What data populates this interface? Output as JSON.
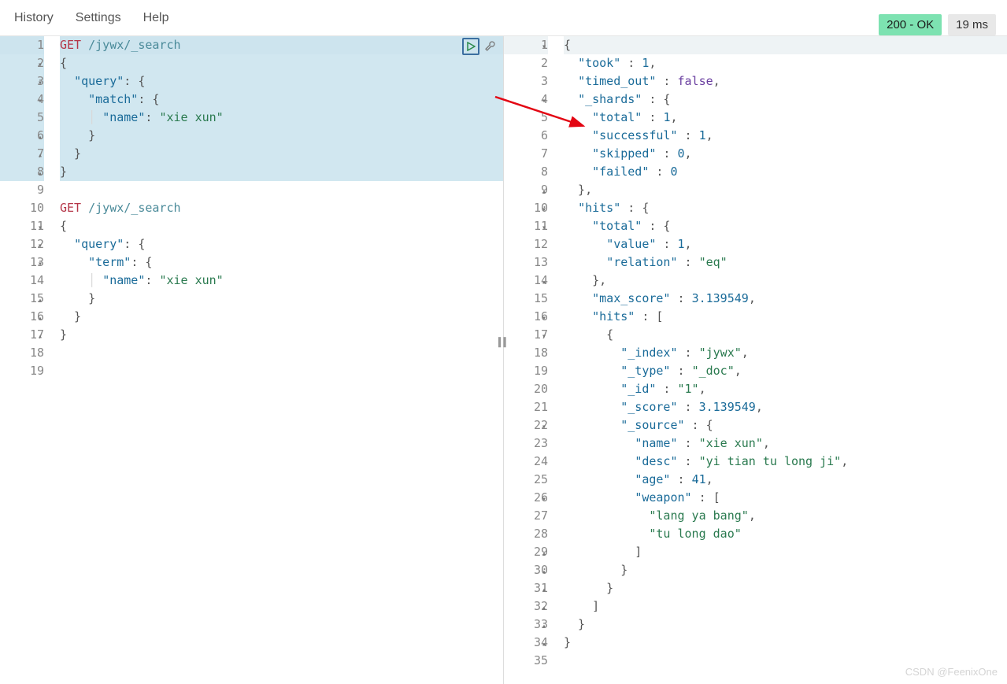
{
  "menu": {
    "history": "History",
    "settings": "Settings",
    "help": "Help"
  },
  "status": {
    "code": "200 - OK",
    "time": "19 ms"
  },
  "watermark": "CSDN @FeenixOne",
  "left_lines": [
    {
      "n": 1,
      "hl": true,
      "first": true,
      "tokens": [
        {
          "t": "GET ",
          "c": "method"
        },
        {
          "t": "/jywx/_search",
          "c": "path"
        }
      ]
    },
    {
      "n": 2,
      "hl": true,
      "fold": "▾",
      "tokens": [
        {
          "t": "{",
          "c": "punct"
        }
      ]
    },
    {
      "n": 3,
      "hl": true,
      "fold": "▾",
      "tokens": [
        {
          "t": "  ",
          "c": ""
        },
        {
          "t": "\"query\"",
          "c": "key"
        },
        {
          "t": ": {",
          "c": "punct"
        }
      ]
    },
    {
      "n": 4,
      "hl": true,
      "fold": "▾",
      "tokens": [
        {
          "t": "    ",
          "c": ""
        },
        {
          "t": "\"match\"",
          "c": "key"
        },
        {
          "t": ": {",
          "c": "punct"
        }
      ]
    },
    {
      "n": 5,
      "hl": true,
      "tokens": [
        {
          "t": "    ",
          "c": ""
        },
        {
          "t": "| ",
          "c": "guide-txt"
        },
        {
          "t": "\"name\"",
          "c": "key"
        },
        {
          "t": ": ",
          "c": "punct"
        },
        {
          "t": "\"xie xun\"",
          "c": "str"
        }
      ]
    },
    {
      "n": 6,
      "hl": true,
      "fold": "▴",
      "tokens": [
        {
          "t": "    }",
          "c": "punct"
        }
      ]
    },
    {
      "n": 7,
      "hl": true,
      "fold": "▴",
      "tokens": [
        {
          "t": "  }",
          "c": "punct"
        }
      ]
    },
    {
      "n": 8,
      "hl": true,
      "fold": "▴",
      "tokens": [
        {
          "t": "}",
          "c": "punct"
        }
      ]
    },
    {
      "n": 9,
      "tokens": []
    },
    {
      "n": 10,
      "tokens": [
        {
          "t": "GET ",
          "c": "method"
        },
        {
          "t": "/jywx/_search",
          "c": "path"
        }
      ]
    },
    {
      "n": 11,
      "fold": "▾",
      "tokens": [
        {
          "t": "{",
          "c": "punct"
        }
      ]
    },
    {
      "n": 12,
      "fold": "▾",
      "tokens": [
        {
          "t": "  ",
          "c": ""
        },
        {
          "t": "\"query\"",
          "c": "key"
        },
        {
          "t": ": {",
          "c": "punct"
        }
      ]
    },
    {
      "n": 13,
      "fold": "▾",
      "tokens": [
        {
          "t": "    ",
          "c": ""
        },
        {
          "t": "\"term\"",
          "c": "key"
        },
        {
          "t": ": {",
          "c": "punct"
        }
      ]
    },
    {
      "n": 14,
      "tokens": [
        {
          "t": "    ",
          "c": ""
        },
        {
          "t": "| ",
          "c": "guide-txt"
        },
        {
          "t": "\"name\"",
          "c": "key"
        },
        {
          "t": ": ",
          "c": "punct"
        },
        {
          "t": "\"xie xun\"",
          "c": "str"
        }
      ]
    },
    {
      "n": 15,
      "fold": "▴",
      "tokens": [
        {
          "t": "    }",
          "c": "punct"
        }
      ]
    },
    {
      "n": 16,
      "fold": "▴",
      "tokens": [
        {
          "t": "  }",
          "c": "punct"
        }
      ]
    },
    {
      "n": 17,
      "fold": "▴",
      "tokens": [
        {
          "t": "}",
          "c": "punct"
        }
      ]
    },
    {
      "n": 18,
      "tokens": []
    },
    {
      "n": 19,
      "tokens": []
    }
  ],
  "right_lines": [
    {
      "n": 1,
      "fold": "▾",
      "tokens": [
        {
          "t": "{",
          "c": "punct"
        }
      ]
    },
    {
      "n": 2,
      "tokens": [
        {
          "t": "  ",
          "c": ""
        },
        {
          "t": "\"took\"",
          "c": "key"
        },
        {
          "t": " : ",
          "c": "punct"
        },
        {
          "t": "1",
          "c": "num"
        },
        {
          "t": ",",
          "c": "punct"
        }
      ]
    },
    {
      "n": 3,
      "tokens": [
        {
          "t": "  ",
          "c": ""
        },
        {
          "t": "\"timed_out\"",
          "c": "key"
        },
        {
          "t": " : ",
          "c": "punct"
        },
        {
          "t": "false",
          "c": "bool"
        },
        {
          "t": ",",
          "c": "punct"
        }
      ]
    },
    {
      "n": 4,
      "fold": "▾",
      "tokens": [
        {
          "t": "  ",
          "c": ""
        },
        {
          "t": "\"_shards\"",
          "c": "key"
        },
        {
          "t": " : {",
          "c": "punct"
        }
      ]
    },
    {
      "n": 5,
      "tokens": [
        {
          "t": "    ",
          "c": ""
        },
        {
          "t": "\"total\"",
          "c": "key"
        },
        {
          "t": " : ",
          "c": "punct"
        },
        {
          "t": "1",
          "c": "num"
        },
        {
          "t": ",",
          "c": "punct"
        }
      ]
    },
    {
      "n": 6,
      "tokens": [
        {
          "t": "    ",
          "c": ""
        },
        {
          "t": "\"successful\"",
          "c": "key"
        },
        {
          "t": " : ",
          "c": "punct"
        },
        {
          "t": "1",
          "c": "num"
        },
        {
          "t": ",",
          "c": "punct"
        }
      ]
    },
    {
      "n": 7,
      "tokens": [
        {
          "t": "    ",
          "c": ""
        },
        {
          "t": "\"skipped\"",
          "c": "key"
        },
        {
          "t": " : ",
          "c": "punct"
        },
        {
          "t": "0",
          "c": "num"
        },
        {
          "t": ",",
          "c": "punct"
        }
      ]
    },
    {
      "n": 8,
      "tokens": [
        {
          "t": "    ",
          "c": ""
        },
        {
          "t": "\"failed\"",
          "c": "key"
        },
        {
          "t": " : ",
          "c": "punct"
        },
        {
          "t": "0",
          "c": "num"
        }
      ]
    },
    {
      "n": 9,
      "fold": "▴",
      "tokens": [
        {
          "t": "  },",
          "c": "punct"
        }
      ]
    },
    {
      "n": 10,
      "fold": "▾",
      "tokens": [
        {
          "t": "  ",
          "c": ""
        },
        {
          "t": "\"hits\"",
          "c": "key"
        },
        {
          "t": " : {",
          "c": "punct"
        }
      ]
    },
    {
      "n": 11,
      "fold": "▾",
      "tokens": [
        {
          "t": "    ",
          "c": ""
        },
        {
          "t": "\"total\"",
          "c": "key"
        },
        {
          "t": " : {",
          "c": "punct"
        }
      ]
    },
    {
      "n": 12,
      "tokens": [
        {
          "t": "      ",
          "c": ""
        },
        {
          "t": "\"value\"",
          "c": "key"
        },
        {
          "t": " : ",
          "c": "punct"
        },
        {
          "t": "1",
          "c": "num"
        },
        {
          "t": ",",
          "c": "punct"
        }
      ]
    },
    {
      "n": 13,
      "tokens": [
        {
          "t": "      ",
          "c": ""
        },
        {
          "t": "\"relation\"",
          "c": "key"
        },
        {
          "t": " : ",
          "c": "punct"
        },
        {
          "t": "\"eq\"",
          "c": "str"
        }
      ]
    },
    {
      "n": 14,
      "fold": "▴",
      "tokens": [
        {
          "t": "    },",
          "c": "punct"
        }
      ]
    },
    {
      "n": 15,
      "tokens": [
        {
          "t": "    ",
          "c": ""
        },
        {
          "t": "\"max_score\"",
          "c": "key"
        },
        {
          "t": " : ",
          "c": "punct"
        },
        {
          "t": "3.139549",
          "c": "num"
        },
        {
          "t": ",",
          "c": "punct"
        }
      ]
    },
    {
      "n": 16,
      "fold": "▾",
      "tokens": [
        {
          "t": "    ",
          "c": ""
        },
        {
          "t": "\"hits\"",
          "c": "key"
        },
        {
          "t": " : [",
          "c": "punct"
        }
      ]
    },
    {
      "n": 17,
      "fold": "▾",
      "tokens": [
        {
          "t": "      {",
          "c": "punct"
        }
      ]
    },
    {
      "n": 18,
      "tokens": [
        {
          "t": "        ",
          "c": ""
        },
        {
          "t": "\"_index\"",
          "c": "key"
        },
        {
          "t": " : ",
          "c": "punct"
        },
        {
          "t": "\"jywx\"",
          "c": "str"
        },
        {
          "t": ",",
          "c": "punct"
        }
      ]
    },
    {
      "n": 19,
      "tokens": [
        {
          "t": "        ",
          "c": ""
        },
        {
          "t": "\"_type\"",
          "c": "key"
        },
        {
          "t": " : ",
          "c": "punct"
        },
        {
          "t": "\"_doc\"",
          "c": "str"
        },
        {
          "t": ",",
          "c": "punct"
        }
      ]
    },
    {
      "n": 20,
      "tokens": [
        {
          "t": "        ",
          "c": ""
        },
        {
          "t": "\"_id\"",
          "c": "key"
        },
        {
          "t": " : ",
          "c": "punct"
        },
        {
          "t": "\"1\"",
          "c": "str"
        },
        {
          "t": ",",
          "c": "punct"
        }
      ]
    },
    {
      "n": 21,
      "tokens": [
        {
          "t": "        ",
          "c": ""
        },
        {
          "t": "\"_score\"",
          "c": "key"
        },
        {
          "t": " : ",
          "c": "punct"
        },
        {
          "t": "3.139549",
          "c": "num"
        },
        {
          "t": ",",
          "c": "punct"
        }
      ]
    },
    {
      "n": 22,
      "fold": "▾",
      "tokens": [
        {
          "t": "        ",
          "c": ""
        },
        {
          "t": "\"_source\"",
          "c": "key"
        },
        {
          "t": " : {",
          "c": "punct"
        }
      ]
    },
    {
      "n": 23,
      "tokens": [
        {
          "t": "          ",
          "c": ""
        },
        {
          "t": "\"name\"",
          "c": "key"
        },
        {
          "t": " : ",
          "c": "punct"
        },
        {
          "t": "\"xie xun\"",
          "c": "str"
        },
        {
          "t": ",",
          "c": "punct"
        }
      ]
    },
    {
      "n": 24,
      "tokens": [
        {
          "t": "          ",
          "c": ""
        },
        {
          "t": "\"desc\"",
          "c": "key"
        },
        {
          "t": " : ",
          "c": "punct"
        },
        {
          "t": "\"yi tian tu long ji\"",
          "c": "str"
        },
        {
          "t": ",",
          "c": "punct"
        }
      ]
    },
    {
      "n": 25,
      "tokens": [
        {
          "t": "          ",
          "c": ""
        },
        {
          "t": "\"age\"",
          "c": "key"
        },
        {
          "t": " : ",
          "c": "punct"
        },
        {
          "t": "41",
          "c": "num"
        },
        {
          "t": ",",
          "c": "punct"
        }
      ]
    },
    {
      "n": 26,
      "fold": "▾",
      "tokens": [
        {
          "t": "          ",
          "c": ""
        },
        {
          "t": "\"weapon\"",
          "c": "key"
        },
        {
          "t": " : [",
          "c": "punct"
        }
      ]
    },
    {
      "n": 27,
      "tokens": [
        {
          "t": "            ",
          "c": ""
        },
        {
          "t": "\"lang ya bang\"",
          "c": "str"
        },
        {
          "t": ",",
          "c": "punct"
        }
      ]
    },
    {
      "n": 28,
      "tokens": [
        {
          "t": "            ",
          "c": ""
        },
        {
          "t": "\"tu long dao\"",
          "c": "str"
        }
      ]
    },
    {
      "n": 29,
      "fold": "▴",
      "tokens": [
        {
          "t": "          ]",
          "c": "punct"
        }
      ]
    },
    {
      "n": 30,
      "fold": "▴",
      "tokens": [
        {
          "t": "        }",
          "c": "punct"
        }
      ]
    },
    {
      "n": 31,
      "fold": "▴",
      "tokens": [
        {
          "t": "      }",
          "c": "punct"
        }
      ]
    },
    {
      "n": 32,
      "fold": "▴",
      "tokens": [
        {
          "t": "    ]",
          "c": "punct"
        }
      ]
    },
    {
      "n": 33,
      "fold": "▴",
      "tokens": [
        {
          "t": "  }",
          "c": "punct"
        }
      ]
    },
    {
      "n": 34,
      "fold": "▴",
      "tokens": [
        {
          "t": "}",
          "c": "punct"
        }
      ]
    },
    {
      "n": 35,
      "tokens": []
    }
  ]
}
